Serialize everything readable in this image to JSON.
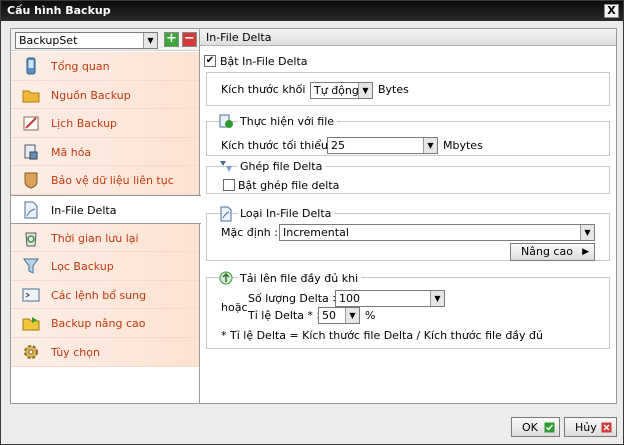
{
  "window": {
    "title": "Cấu hình Backup",
    "close_symbol": "X"
  },
  "backupset": {
    "selected": "BackupSet",
    "add_symbol": "+",
    "remove_symbol": "−"
  },
  "sidebar": {
    "items": [
      {
        "label": "Tổng quan",
        "icon": "phone-icon"
      },
      {
        "label": "Nguồn Backup",
        "icon": "folder-icon"
      },
      {
        "label": "Lịch Backup",
        "icon": "schedule-icon"
      },
      {
        "label": "Mã hóa",
        "icon": "lock-icon"
      },
      {
        "label": "Bảo vệ dữ liệu liên tục",
        "icon": "shield-icon"
      },
      {
        "label": "In-File Delta",
        "icon": "document-icon"
      },
      {
        "label": "Thời gian lưu lại",
        "icon": "recycle-bin-icon"
      },
      {
        "label": "Lọc Backup",
        "icon": "filter-icon"
      },
      {
        "label": "Các lệnh bổ sung",
        "icon": "command-icon"
      },
      {
        "label": "Backup nâng cao",
        "icon": "advanced-folder-icon"
      },
      {
        "label": "Tùy chọn",
        "icon": "gear-icon"
      }
    ],
    "active_index": 5
  },
  "panel": {
    "header": "In-File Delta",
    "enable_checkbox": {
      "label": "Bật In-File Delta",
      "checked": true
    },
    "block_size": {
      "label": "Kích thước khối :",
      "value": "Tự động",
      "unit": "Bytes"
    },
    "file_group": {
      "title": "Thực hiện với file",
      "min_size_label": "Kích thước tối thiểu :",
      "min_size_value": "25",
      "min_size_unit": "Mbytes"
    },
    "merge_group": {
      "title": "Ghép file Delta",
      "checkbox_label": "Bật ghép file delta",
      "checked": false
    },
    "type_group": {
      "title": "Loại In-File Delta",
      "default_label": "Mặc định :",
      "default_value": "Incremental",
      "advanced_button": "Nâng cao"
    },
    "upload_group": {
      "title": "Tải lên file đầy đủ khi",
      "or_label": "hoặc",
      "delta_count_label": "Số lượng Delta >",
      "delta_count_value": "100",
      "delta_ratio_label": "Tỉ lệ Delta * >",
      "delta_ratio_value": "50",
      "delta_ratio_unit": "%",
      "footnote": "* Tỉ lệ Delta = Kích thước file Delta / Kích thước file đầy đủ"
    }
  },
  "footer": {
    "ok_label": "OK",
    "cancel_label": "Hủy"
  },
  "colors": {
    "nav_text": "#c0390f",
    "ok_icon": "#2f9a2f",
    "cancel_icon": "#d23a3a"
  }
}
